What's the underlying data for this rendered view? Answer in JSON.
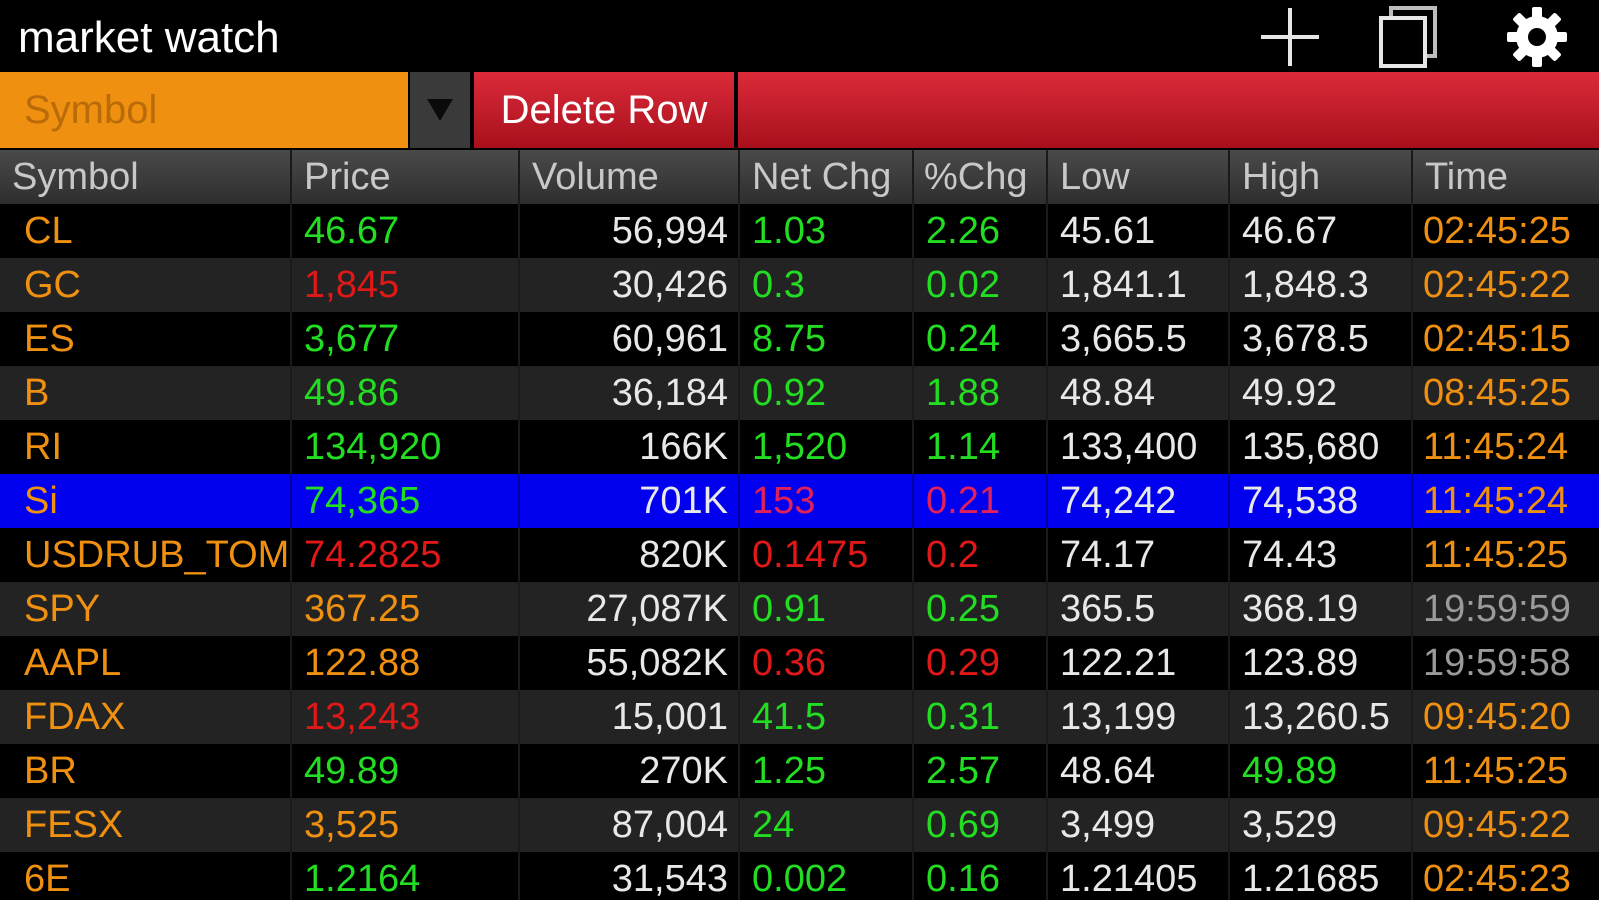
{
  "window": {
    "title": "market watch"
  },
  "toolbar": {
    "symbol_select_value": "Symbol",
    "delete_row_label": "Delete Row"
  },
  "icons": {
    "add": "plus-icon",
    "windows": "windows-icon",
    "settings": "gear-icon",
    "dropdown": "triangle-down-icon"
  },
  "colors": {
    "orange": "#f09010",
    "green": "#22dd22",
    "red": "#e01818",
    "selected_row": "#0000ee",
    "delete_button": "#c81c2c"
  },
  "table": {
    "columns": [
      "Symbol",
      "Price",
      "Volume",
      "Net Chg",
      "%Chg",
      "Low",
      "High",
      "Time"
    ],
    "rows": [
      {
        "symbol": "CL",
        "price": "46.67",
        "volume": "56,994",
        "net_chg": "1.03",
        "pct_chg": "2.26",
        "low": "45.61",
        "high": "46.67",
        "time": "02:45:25",
        "price_color": "green",
        "chg_color": "green",
        "high_color": "white",
        "time_color": "orange",
        "selected": false
      },
      {
        "symbol": "GC",
        "price": "1,845",
        "volume": "30,426",
        "net_chg": "0.3",
        "pct_chg": "0.02",
        "low": "1,841.1",
        "high": "1,848.3",
        "time": "02:45:22",
        "price_color": "red",
        "chg_color": "green",
        "high_color": "white",
        "time_color": "orange",
        "selected": false
      },
      {
        "symbol": "ES",
        "price": "3,677",
        "volume": "60,961",
        "net_chg": "8.75",
        "pct_chg": "0.24",
        "low": "3,665.5",
        "high": "3,678.5",
        "time": "02:45:15",
        "price_color": "green",
        "chg_color": "green",
        "high_color": "white",
        "time_color": "orange",
        "selected": false
      },
      {
        "symbol": "B",
        "price": "49.86",
        "volume": "36,184",
        "net_chg": "0.92",
        "pct_chg": "1.88",
        "low": "48.84",
        "high": "49.92",
        "time": "08:45:25",
        "price_color": "green",
        "chg_color": "green",
        "high_color": "white",
        "time_color": "orange",
        "selected": false
      },
      {
        "symbol": "RI",
        "price": "134,920",
        "volume": "166K",
        "net_chg": "1,520",
        "pct_chg": "1.14",
        "low": "133,400",
        "high": "135,680",
        "time": "11:45:24",
        "price_color": "green",
        "chg_color": "green",
        "high_color": "white",
        "time_color": "orange",
        "selected": false
      },
      {
        "symbol": "Si",
        "price": "74,365",
        "volume": "701K",
        "net_chg": "153",
        "pct_chg": "0.21",
        "low": "74,242",
        "high": "74,538",
        "time": "11:45:24",
        "price_color": "green",
        "chg_color": "magenta",
        "high_color": "white",
        "time_color": "orange",
        "selected": true
      },
      {
        "symbol": "USDRUB_TOM",
        "price": "74.2825",
        "volume": "820K",
        "net_chg": "0.1475",
        "pct_chg": "0.2",
        "low": "74.17",
        "high": "74.43",
        "time": "11:45:25",
        "price_color": "red",
        "chg_color": "red",
        "high_color": "white",
        "time_color": "orange",
        "selected": false
      },
      {
        "symbol": "SPY",
        "price": "367.25",
        "volume": "27,087K",
        "net_chg": "0.91",
        "pct_chg": "0.25",
        "low": "365.5",
        "high": "368.19",
        "time": "19:59:59",
        "price_color": "orange",
        "chg_color": "green",
        "high_color": "white",
        "time_color": "gray",
        "selected": false
      },
      {
        "symbol": "AAPL",
        "price": "122.88",
        "volume": "55,082K",
        "net_chg": "0.36",
        "pct_chg": "0.29",
        "low": "122.21",
        "high": "123.89",
        "time": "19:59:58",
        "price_color": "orange",
        "chg_color": "red",
        "high_color": "white",
        "time_color": "gray",
        "selected": false
      },
      {
        "symbol": "FDAX",
        "price": "13,243",
        "volume": "15,001",
        "net_chg": "41.5",
        "pct_chg": "0.31",
        "low": "13,199",
        "high": "13,260.5",
        "time": "09:45:20",
        "price_color": "red",
        "chg_color": "green",
        "high_color": "white",
        "time_color": "orange",
        "selected": false
      },
      {
        "symbol": "BR",
        "price": "49.89",
        "volume": "270K",
        "net_chg": "1.25",
        "pct_chg": "2.57",
        "low": "48.64",
        "high": "49.89",
        "time": "11:45:25",
        "price_color": "green",
        "chg_color": "green",
        "high_color": "green",
        "time_color": "orange",
        "selected": false
      },
      {
        "symbol": "FESX",
        "price": "3,525",
        "volume": "87,004",
        "net_chg": "24",
        "pct_chg": "0.69",
        "low": "3,499",
        "high": "3,529",
        "time": "09:45:22",
        "price_color": "orange",
        "chg_color": "green",
        "high_color": "white",
        "time_color": "orange",
        "selected": false
      },
      {
        "symbol": "6E",
        "price": "1.2164",
        "volume": "31,543",
        "net_chg": "0.002",
        "pct_chg": "0.16",
        "low": "1.21405",
        "high": "1.21685",
        "time": "02:45:23",
        "price_color": "green",
        "chg_color": "green",
        "high_color": "white",
        "time_color": "orange",
        "selected": false
      }
    ]
  }
}
